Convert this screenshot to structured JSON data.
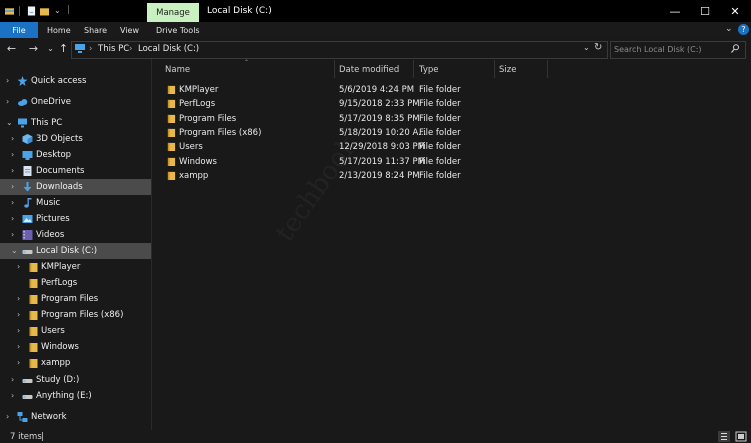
{
  "window": {
    "title": "Local Disk (C:)",
    "manage_label": "Manage",
    "minimize": "—",
    "maximize": "☐",
    "close": "✕"
  },
  "ribbon": {
    "tabs": [
      "File",
      "Home",
      "Share",
      "View",
      "Drive Tools"
    ],
    "collapse_chevron": "⌄",
    "help": "?"
  },
  "address": {
    "back": "←",
    "forward": "→",
    "recent": "⌄",
    "up": "↑",
    "crumbs": [
      "This PC",
      "Local Disk (C:)"
    ],
    "separator": "›",
    "dropdown": "⌄",
    "refresh": "↻"
  },
  "search": {
    "placeholder": "Search Local Disk (C:)"
  },
  "sidebar": {
    "items": [
      {
        "label": "Quick access",
        "icon": "star-icon",
        "chevron": "›",
        "level": 0
      },
      {
        "label": "OneDrive",
        "icon": "cloud-icon",
        "chevron": "›",
        "level": 0
      },
      {
        "label": "This PC",
        "icon": "computer-icon",
        "chevron": "⌄",
        "level": 0
      },
      {
        "label": "3D Objects",
        "icon": "cube-icon",
        "chevron": "›",
        "level": 1
      },
      {
        "label": "Desktop",
        "icon": "desktop-icon",
        "chevron": "›",
        "level": 1
      },
      {
        "label": "Documents",
        "icon": "document-icon",
        "chevron": "›",
        "level": 1
      },
      {
        "label": "Downloads",
        "icon": "download-icon",
        "chevron": "›",
        "level": 1,
        "selected": true
      },
      {
        "label": "Music",
        "icon": "music-icon",
        "chevron": "›",
        "level": 1
      },
      {
        "label": "Pictures",
        "icon": "picture-icon",
        "chevron": "›",
        "level": 1
      },
      {
        "label": "Videos",
        "icon": "video-icon",
        "chevron": "›",
        "level": 1
      },
      {
        "label": "Local Disk (C:)",
        "icon": "drive-icon",
        "chevron": "⌄",
        "level": 1,
        "selected": true
      },
      {
        "label": "KMPlayer",
        "icon": "folder-icon",
        "chevron": "›",
        "level": 2
      },
      {
        "label": "PerfLogs",
        "icon": "folder-icon",
        "chevron": "",
        "level": 2
      },
      {
        "label": "Program Files",
        "icon": "folder-icon",
        "chevron": "›",
        "level": 2
      },
      {
        "label": "Program Files (x86)",
        "icon": "folder-icon",
        "chevron": "›",
        "level": 2
      },
      {
        "label": "Users",
        "icon": "folder-icon",
        "chevron": "›",
        "level": 2
      },
      {
        "label": "Windows",
        "icon": "folder-icon",
        "chevron": "›",
        "level": 2
      },
      {
        "label": "xampp",
        "icon": "folder-icon",
        "chevron": "›",
        "level": 2
      },
      {
        "label": "Study (D:)",
        "icon": "drive-icon",
        "chevron": "›",
        "level": 1
      },
      {
        "label": "Anything (E:)",
        "icon": "drive-icon",
        "chevron": "›",
        "level": 1
      },
      {
        "label": "Network",
        "icon": "network-icon",
        "chevron": "›",
        "level": 0
      }
    ]
  },
  "columns": {
    "name": "Name",
    "date": "Date modified",
    "type": "Type",
    "size": "Size",
    "sort_arrow": "⌃"
  },
  "files": [
    {
      "name": "KMPlayer",
      "date": "5/6/2019 4:24 PM",
      "type": "File folder"
    },
    {
      "name": "PerfLogs",
      "date": "9/15/2018 2:33 PM",
      "type": "File folder"
    },
    {
      "name": "Program Files",
      "date": "5/17/2019 8:35 PM",
      "type": "File folder"
    },
    {
      "name": "Program Files (x86)",
      "date": "5/18/2019 10:20 A...",
      "type": "File folder"
    },
    {
      "name": "Users",
      "date": "12/29/2018 9:03 PM",
      "type": "File folder"
    },
    {
      "name": "Windows",
      "date": "5/17/2019 11:37 PM",
      "type": "File folder"
    },
    {
      "name": "xampp",
      "date": "2/13/2019 8:24 PM",
      "type": "File folder"
    }
  ],
  "status": {
    "items_count": "7 items",
    "separator": "|"
  },
  "watermark": "techbook",
  "colors": {
    "accent": "#1b71c4",
    "folder": "#e8b94a",
    "manage_tab": "#c8f0c0",
    "selection": "#4b4b4b"
  }
}
